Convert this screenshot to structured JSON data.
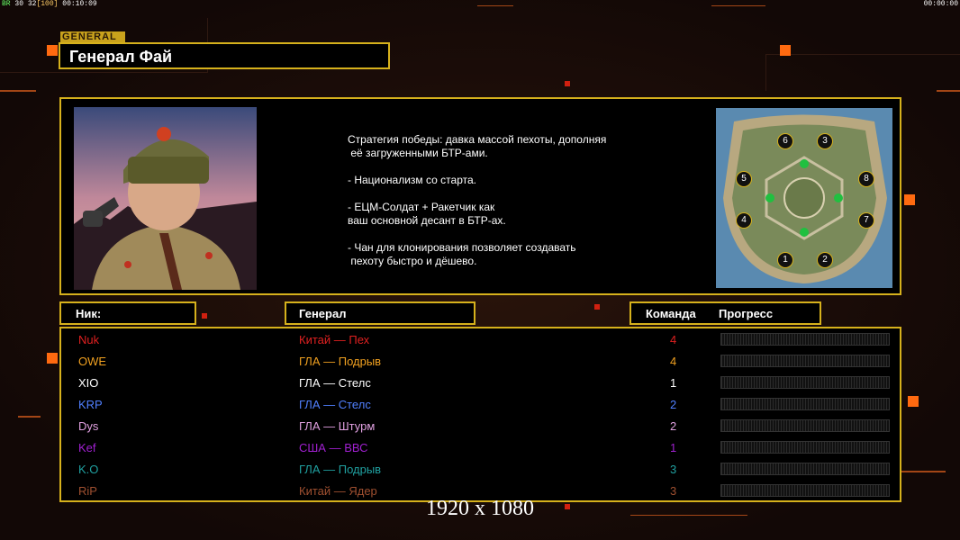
{
  "hud": {
    "left_prefix": "BR",
    "left_a": "30",
    "left_b": "32",
    "left_c": "[100]",
    "left_time": "00:10:09",
    "right_time": "00:00:00"
  },
  "general": {
    "tag": "GENERAL",
    "name": "Генерал Фай",
    "strategy": "Стратегия победы: давка массой пехоты, дополняя\n её загруженными БТР-ами.\n\n- Национализм со старта.\n\n- ЕЦМ-Солдат + Ракетчик как\nваш основной десант в БТР-ах.\n\n- Чан для клонирования позволяет создавать\n пехоту быстро и дёшево."
  },
  "map": {
    "slots": [
      "6",
      "3",
      "5",
      "8",
      "4",
      "7",
      "1",
      "2"
    ]
  },
  "headers": {
    "nick": "Ник:",
    "general": "Генерал",
    "team": "Команда",
    "progress": "Прогресс"
  },
  "players": [
    {
      "nick": "Nuk",
      "general": "Китай — Пех",
      "team": "4",
      "color": "#e02020",
      "progress": 0
    },
    {
      "nick": "OWE",
      "general": "ГЛА — Подрыв",
      "team": "4",
      "color": "#f0a020",
      "progress": 0
    },
    {
      "nick": "XIO",
      "general": "ГЛА — Стелс",
      "team": "1",
      "color": "#ffffff",
      "progress": 0
    },
    {
      "nick": "KRP",
      "general": "ГЛА — Стелс",
      "team": "2",
      "color": "#5080ff",
      "progress": 0
    },
    {
      "nick": "Dys",
      "general": "ГЛА — Штурм",
      "team": "2",
      "color": "#e0a0e0",
      "progress": 0
    },
    {
      "nick": "Kef",
      "general": "США — ВВС",
      "team": "1",
      "color": "#a020d0",
      "progress": 0
    },
    {
      "nick": "K.O",
      "general": "ГЛА — Подрыв",
      "team": "3",
      "color": "#20a0a0",
      "progress": 0
    },
    {
      "nick": "RiP",
      "general": "Китай — Ядер",
      "team": "3",
      "color": "#a05030",
      "progress": 0
    }
  ],
  "resolution_label": "1920 x 1080",
  "colors": {
    "frame": "#d6b11c",
    "accent": "#ff6a10"
  }
}
